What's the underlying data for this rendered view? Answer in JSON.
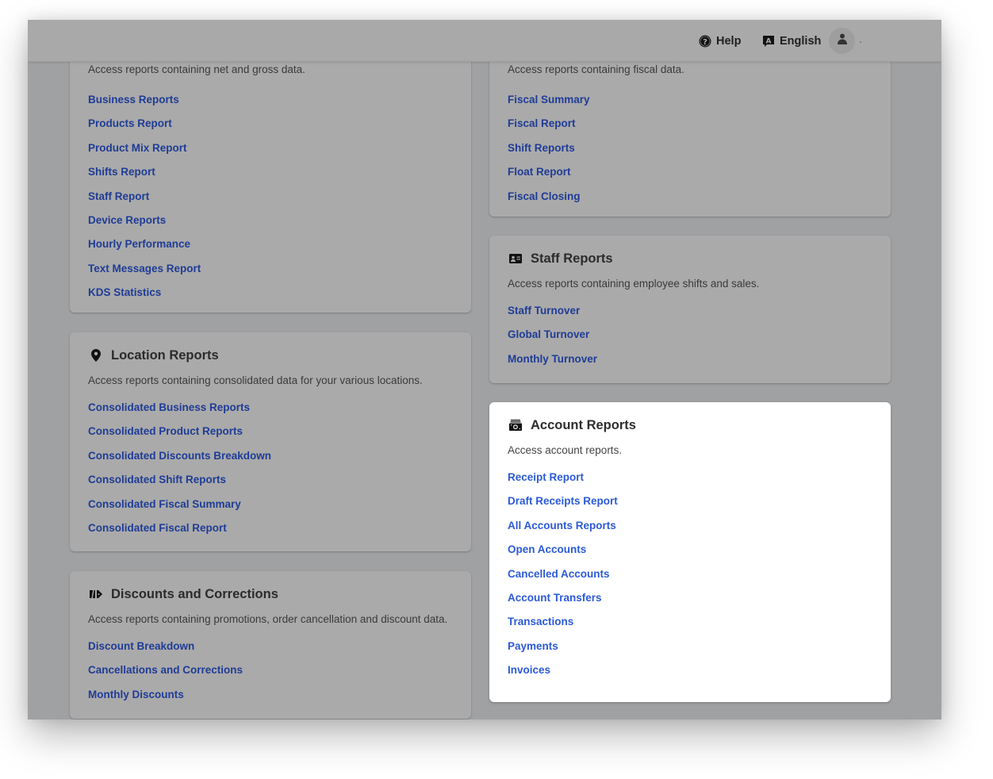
{
  "header": {
    "help_label": "Help",
    "language_label": "English",
    "help_icon": "question-circle-icon",
    "language_icon": "language-icon",
    "user_icon": "user-icon"
  },
  "cards": {
    "sales": {
      "description": "Access reports containing net and gross data.",
      "links": [
        "Business Reports",
        "Products Report",
        "Product Mix Report",
        "Shifts Report",
        "Staff Report",
        "Device Reports",
        "Hourly Performance",
        "Text Messages Report",
        "KDS Statistics"
      ]
    },
    "fiscal": {
      "description": "Access reports containing fiscal data.",
      "links": [
        "Fiscal Summary",
        "Fiscal Report",
        "Shift Reports",
        "Float Report",
        "Fiscal Closing"
      ]
    },
    "location": {
      "title": "Location Reports",
      "icon": "map-pin-icon",
      "description": "Access reports containing consolidated data for your various locations.",
      "links": [
        "Consolidated Business Reports",
        "Consolidated Product Reports",
        "Consolidated Discounts Breakdown",
        "Consolidated Shift Reports",
        "Consolidated Fiscal Summary",
        "Consolidated Fiscal Report"
      ]
    },
    "staff": {
      "title": "Staff Reports",
      "icon": "id-card-icon",
      "description": "Access reports containing employee shifts and sales.",
      "links": [
        "Staff Turnover",
        "Global Turnover",
        "Monthly Turnover"
      ]
    },
    "discounts": {
      "title": "Discounts and Corrections",
      "icon": "ticket-icon",
      "description": "Access reports containing promotions, order cancellation and discount data.",
      "links": [
        "Discount Breakdown",
        "Cancellations and Corrections",
        "Monthly Discounts"
      ]
    },
    "account": {
      "title": "Account Reports",
      "icon": "cash-register-icon",
      "description": "Access account reports.",
      "links": [
        "Receipt Report",
        "Draft Receipts Report",
        "All Accounts Reports",
        "Open Accounts",
        "Cancelled Accounts",
        "Account Transfers",
        "Transactions",
        "Payments",
        "Invoices"
      ]
    }
  },
  "colors": {
    "link_dimmed": "#1f3c96",
    "link_active": "#2b5ad8",
    "overlay_bg": "#a0a1a3",
    "card_dimmed": "#aaaaaa",
    "card_active": "#ffffff"
  }
}
